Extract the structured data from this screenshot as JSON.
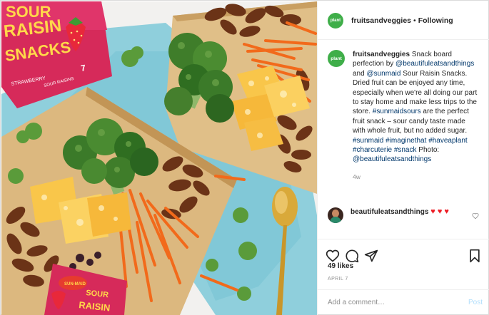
{
  "post": {
    "image_alt": "Snack board with Sun-Maid Sour Raisin Snacks, broccoli, carrots, cheese and pecans",
    "package_brand": "SUN-MAID",
    "package_line1": "SOUR",
    "package_line2": "RAISIN",
    "package_line3": "SNACKS",
    "package_flavor": "STRAWBERRY",
    "package_count": "7",
    "package_sub": "SOUR RAISINS"
  },
  "header": {
    "avatar_text": "plant",
    "username": "fruitsandveggies",
    "separator": "•",
    "follow_status": "Following"
  },
  "caption": {
    "username": "fruitsandveggies",
    "text1": "Snack board perfection by",
    "mention1": "@beautifuleatsandthings",
    "text2": "and",
    "mention2": "@sunmaid",
    "text3": "Sour Raisin Snacks. Dried fruit can be enjoyed any time, especially when we're all doing our part to stay home and make less trips to the store.",
    "hashtag1": "#sunmaidsours",
    "text4": "are the perfect fruit snack – sour candy taste made with whole fruit, but no added sugar.",
    "hashtag2": "#sunmaid",
    "hashtag3": "#imaginethat",
    "hashtag4": "#haveaplant",
    "hashtag5": "#charcuterie",
    "hashtag6": "#snack",
    "photo_credit": "Photo:",
    "mention3": "@beautifuleatsandthings",
    "age": "4w"
  },
  "comment": {
    "username": "beautifuleatsandthings",
    "text": "♥ ♥ ♥"
  },
  "stats": {
    "likes": "49 likes",
    "date": "APRIL 7"
  },
  "add_comment": {
    "placeholder": "Add a comment…",
    "post_label": "Post"
  },
  "colors": {
    "accent_link": "#00376b",
    "brand_green": "#3fae49",
    "heart_red": "#ed1c24",
    "post_disabled": "#b2dffc"
  },
  "icons": [
    "heart-icon",
    "comment-icon",
    "share-icon",
    "bookmark-icon",
    "small-heart-icon"
  ]
}
